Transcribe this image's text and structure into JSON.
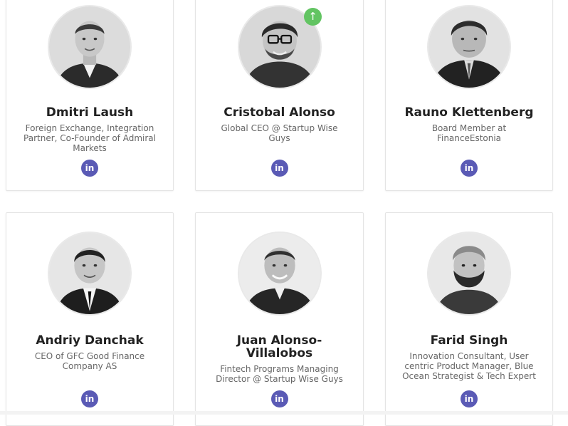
{
  "team": {
    "members": [
      {
        "name": "Dmitri Laush",
        "role": "Foreign Exchange, Integration Partner, Co-Founder of Admiral Markets",
        "link_label": "in"
      },
      {
        "name": "Cristobal Alonso",
        "role": "Global CEO @ Startup Wise Guys",
        "link_label": "in"
      },
      {
        "name": "Rauno Klettenberg",
        "role": "Board Member at FinanceEstonia",
        "link_label": "in"
      },
      {
        "name": "Andriy Danchak",
        "role": "CEO of GFC Good Finance Company AS",
        "link_label": "in"
      },
      {
        "name": "Juan Alonso-Villalobos",
        "role": "Fintech Programs Managing Director @ Startup Wise Guys",
        "link_label": "in"
      },
      {
        "name": "Farid Singh",
        "role": "Innovation Consultant, User centric Product Manager, Blue Ocean Strategist & Tech Expert",
        "link_label": "in"
      }
    ]
  },
  "scroll_top": {
    "icon": "arrow-up-icon",
    "glyph": "↑"
  },
  "colors": {
    "linkedin_badge": "#5a5ab5",
    "scroll_top_badge": "#62c462",
    "name_text": "#222222",
    "role_text": "#666666"
  }
}
